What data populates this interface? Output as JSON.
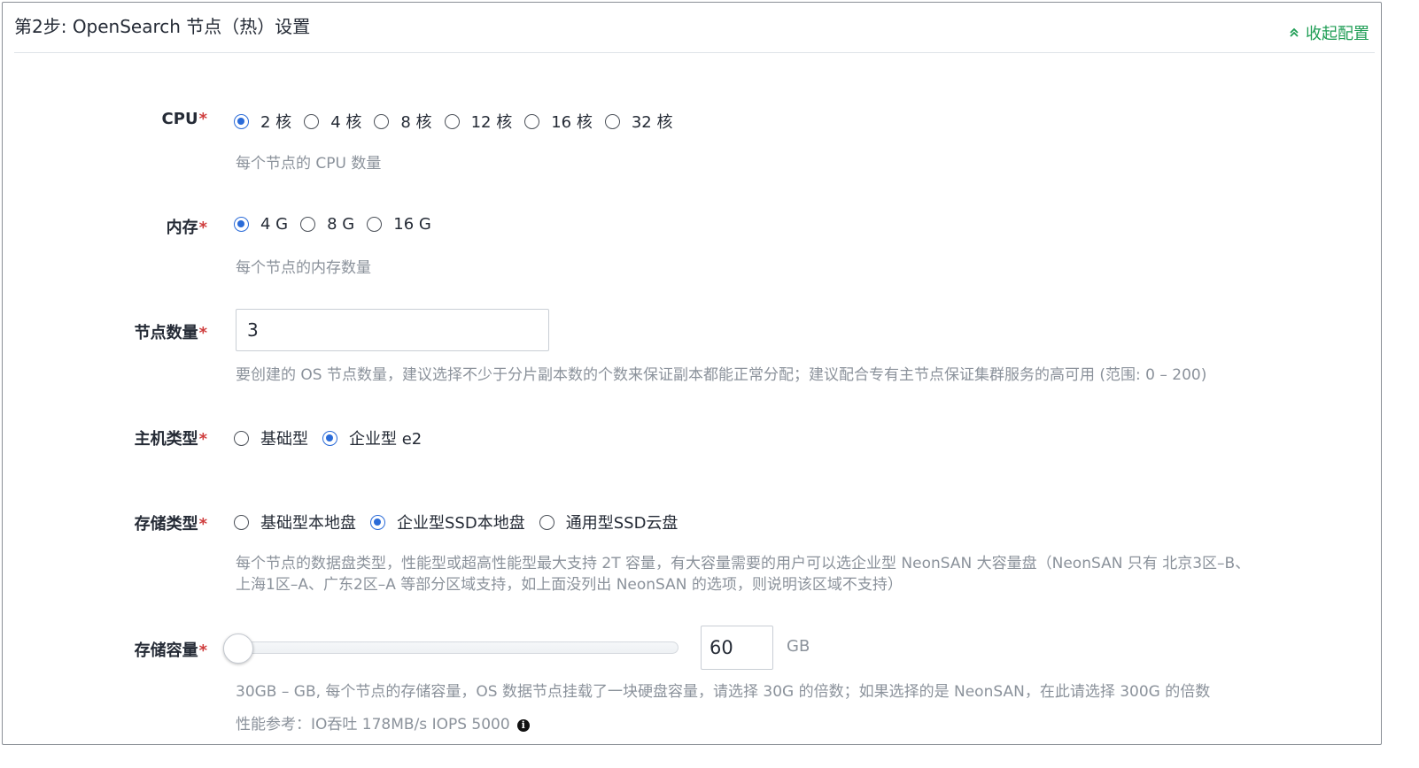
{
  "header": {
    "title": "第2步: OpenSearch 节点（热）设置",
    "collapse_label": "收起配置"
  },
  "cpu": {
    "label": "CPU",
    "required_mark": "*",
    "options": [
      "2 核",
      "4 核",
      "8 核",
      "12 核",
      "16 核",
      "32 核"
    ],
    "selected": "2 核",
    "help": "每个节点的 CPU 数量"
  },
  "memory": {
    "label": "内存",
    "required_mark": "*",
    "options": [
      "4 G",
      "8 G",
      "16 G"
    ],
    "selected": "4 G",
    "help": "每个节点的内存数量"
  },
  "node_count": {
    "label": "节点数量",
    "required_mark": "*",
    "value": "3",
    "help": "要创建的 OS 节点数量，建议选择不少于分片副本数的个数来保证副本都能正常分配；建议配合专有主节点保证集群服务的高可用 (范围: 0 – 200)"
  },
  "host_type": {
    "label": "主机类型",
    "required_mark": "*",
    "options": [
      "基础型",
      "企业型 e2"
    ],
    "selected": "企业型 e2"
  },
  "storage_type": {
    "label": "存储类型",
    "required_mark": "*",
    "options": [
      "基础型本地盘",
      "企业型SSD本地盘",
      "通用型SSD云盘"
    ],
    "selected": "企业型SSD本地盘",
    "help_line1": "每个节点的数据盘类型，性能型或超高性能型最大支持 2T 容量，有大容量需要的用户可以选企业型 NeonSAN 大容量盘（NeonSAN 只有 北京3区–B、",
    "help_line2": "上海1区–A、广东2区–A 等部分区域支持，如上面没列出 NeonSAN 的选项，则说明该区域不支持）"
  },
  "storage_capacity": {
    "label": "存储容量",
    "required_mark": "*",
    "value": "60",
    "unit": "GB",
    "slider_fraction": 0.0,
    "help": "30GB – GB, 每个节点的存储容量，OS 数据节点挂载了一块硬盘容量，请选择 30G 的倍数；如果选择的是 NeonSAN，在此请选择 300G 的倍数",
    "perf": "性能参考：IO吞吐 178MB/s   IOPS 5000",
    "info_icon": "info-icon"
  },
  "colors": {
    "accent_blue": "#2a6bd8",
    "accent_green": "#1f9d55",
    "required_red": "#cf3d3d",
    "help_gray": "#8b929b"
  }
}
